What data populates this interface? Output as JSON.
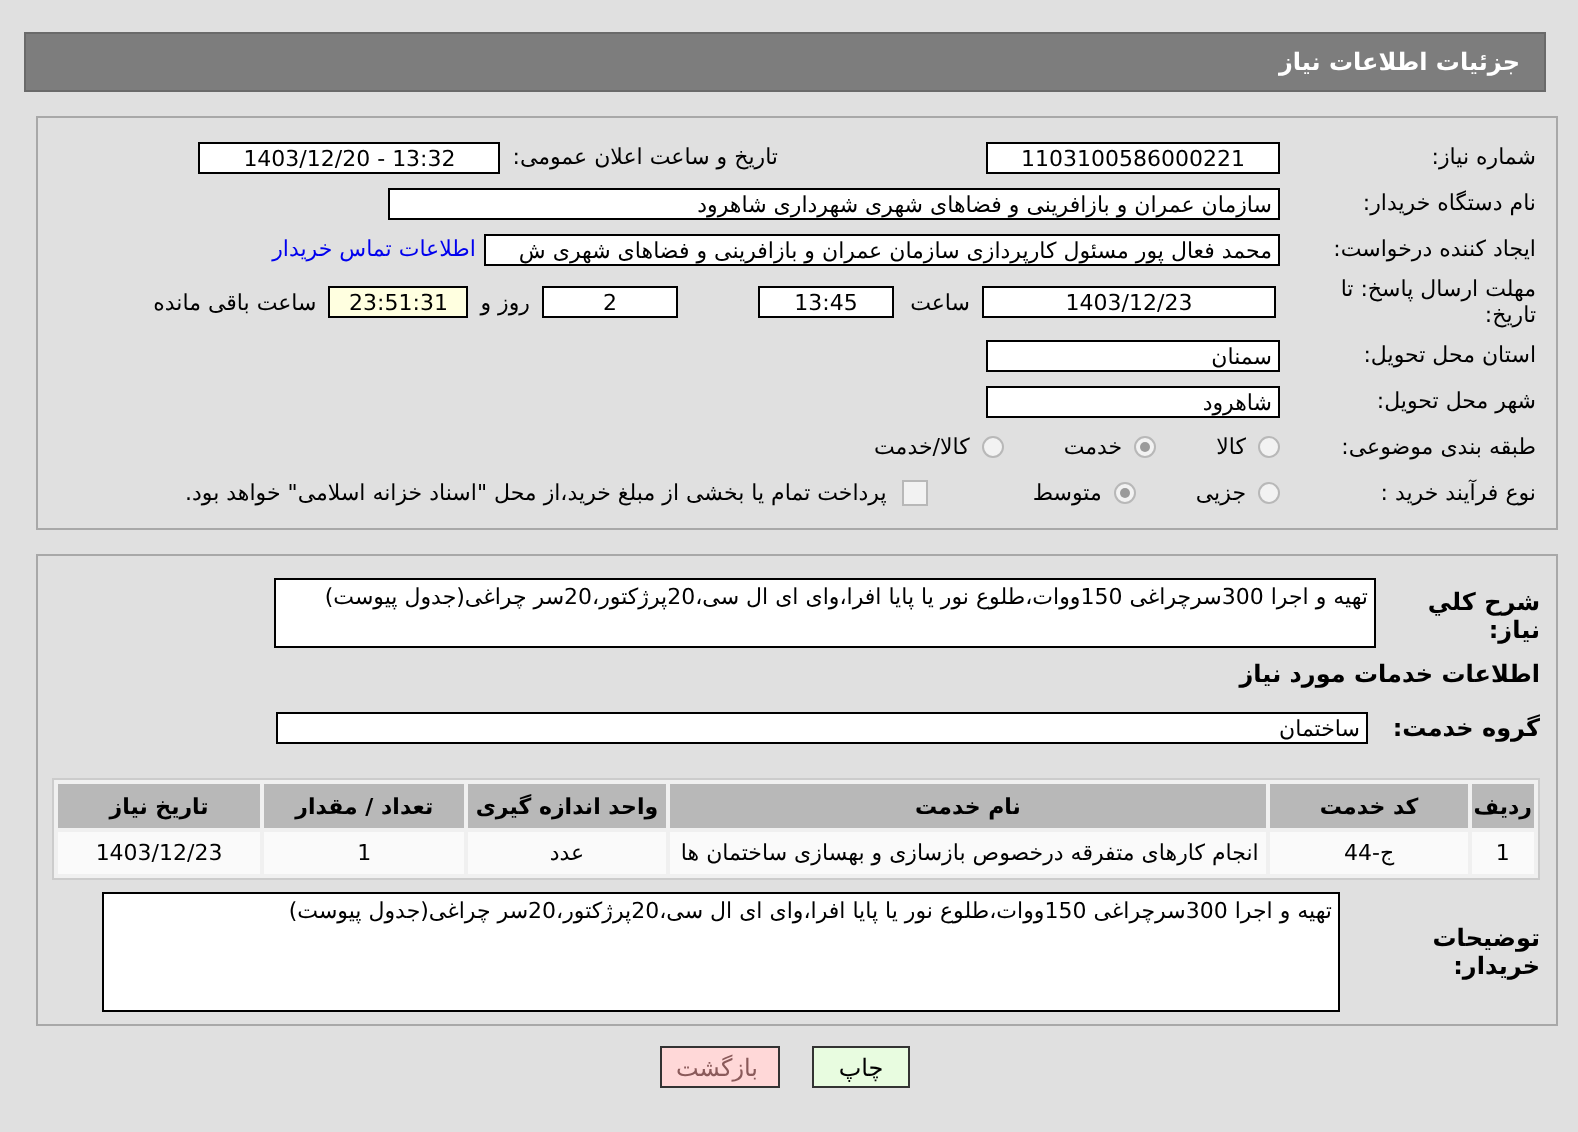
{
  "header": {
    "title": "جزئیات اطلاعات نیاز"
  },
  "details": {
    "need_number": {
      "label": "شماره نیاز:",
      "value": "1103100586000221"
    },
    "announce": {
      "label": "تاریخ و ساعت اعلان عمومی:",
      "value": "13:32 - 1403/12/20"
    },
    "buyer": {
      "label": "نام دستگاه خریدار:",
      "value": "سازمان عمران و بازافرینی و فضاهای شهری شهرداری شاهرود"
    },
    "creator": {
      "label": "ایجاد کننده درخواست:",
      "value": "محمد فعال پور مسئول کارپردازی سازمان عمران و بازافرینی و فضاهای شهری ش",
      "link": "اطلاعات تماس خریدار"
    },
    "deadline": {
      "label": "مهلت ارسال پاسخ: تا تاریخ:",
      "date": "1403/12/23",
      "time_label": "ساعت",
      "time": "13:45",
      "days": "2",
      "days_label": "روز و",
      "remaining": "23:51:31",
      "remaining_label": "ساعت باقی مانده"
    },
    "province": {
      "label": "استان محل تحویل:",
      "value": "سمنان"
    },
    "city": {
      "label": "شهر محل تحویل:",
      "value": "شاهرود"
    },
    "category": {
      "label": "طبقه بندی موضوعی:",
      "options": [
        {
          "label": "کالا",
          "selected": false
        },
        {
          "label": "خدمت",
          "selected": true
        },
        {
          "label": "کالا/خدمت",
          "selected": false
        }
      ]
    },
    "process": {
      "label": "نوع فرآیند خرید :",
      "options": [
        {
          "label": "جزیی",
          "selected": false
        },
        {
          "label": "متوسط",
          "selected": true
        }
      ],
      "payment": {
        "label": "پرداخت تمام یا بخشی از مبلغ خرید،از محل \"اسناد خزانه اسلامی\" خواهد بود.",
        "checked": false
      }
    }
  },
  "needs": {
    "description": {
      "label": "شرح کلي نياز:",
      "value": "تهیه و اجرا 300سرچراغی 150ووات،طلوع نور یا پایا افرا،وای ای ال سی،20پرژکتور،20سر چراغی(جدول پیوست)"
    },
    "section_title": "اطلاعات خدمات مورد نیاز",
    "service_group": {
      "label": "گروه خدمت:",
      "value": "ساختمان"
    },
    "table": {
      "columns": [
        "ردیف",
        "کد خدمت",
        "نام خدمت",
        "واحد اندازه گیری",
        "تعداد / مقدار",
        "تاریخ نیاز"
      ],
      "rows": [
        [
          "1",
          "ج-44",
          "انجام کارهای متفرقه درخصوص بازسازی و بهسازی ساختمان ها",
          "عدد",
          "1",
          "1403/12/23"
        ]
      ]
    },
    "buyer_notes": {
      "label": "توضیحات خریدار:",
      "value": "تهیه و اجرا 300سرچراغی 150ووات،طلوع نور یا پایا افرا،وای ای ال سی،20پرژکتور،20سر چراغی(جدول پیوست)"
    }
  },
  "buttons": [
    {
      "label": "چاپ",
      "kind": "print"
    },
    {
      "label": "بازگشت",
      "kind": "back"
    }
  ]
}
